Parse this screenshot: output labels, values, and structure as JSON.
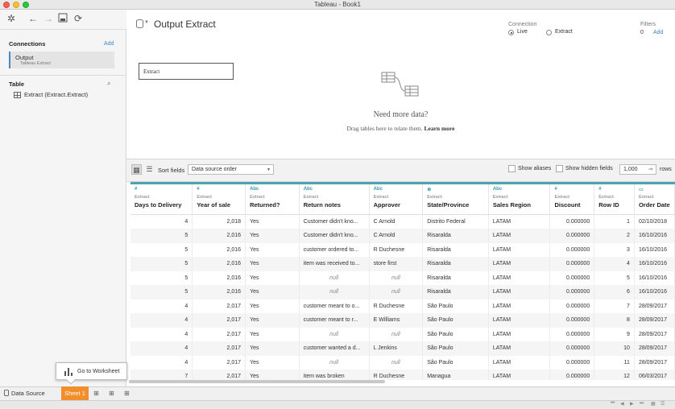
{
  "window": {
    "title": "Tableau - Book1"
  },
  "left_panel": {
    "connections_heading": "Connections",
    "connections_add": "Add",
    "connection": {
      "name": "Output",
      "type": "Tableau Extract"
    },
    "table_heading": "Table",
    "table_item": "Extract (Extract.Extract)"
  },
  "header": {
    "datasource_title": "Output Extract",
    "connection_label": "Connection",
    "connection_live": "Live",
    "connection_extract": "Extract",
    "connection_selected": "Live",
    "filters_label": "Filters",
    "filters_count": "0",
    "filters_add": "Add"
  },
  "canvas": {
    "table_box": "Extract",
    "need_more_title": "Need more data?",
    "need_more_text": "Drag tables here to relate them.",
    "learn_more": "Learn more"
  },
  "grid_toolbar": {
    "sort_label": "Sort fields",
    "sort_value": "Data source order",
    "show_aliases": "Show aliases",
    "show_hidden": "Show hidden fields",
    "rows_value": "1,000",
    "rows_label": "rows"
  },
  "columns": [
    {
      "type": "#",
      "source": "Extract",
      "name": "Days to Delivery"
    },
    {
      "type": "#",
      "source": "Extract",
      "name": "Year of sale"
    },
    {
      "type": "Abc",
      "source": "Extract",
      "name": "Returned?"
    },
    {
      "type": "Abc",
      "source": "Extract",
      "name": "Return notes"
    },
    {
      "type": "Abc",
      "source": "Extract",
      "name": "Approver"
    },
    {
      "type": "globe",
      "source": "Extract",
      "name": "State/Province"
    },
    {
      "type": "Abc",
      "source": "Extract",
      "name": "Sales Region"
    },
    {
      "type": "#",
      "source": "Extract",
      "name": "Discount"
    },
    {
      "type": "#",
      "source": "Extract",
      "name": "Row ID"
    },
    {
      "type": "calendar",
      "source": "Extract",
      "name": "Order Date"
    }
  ],
  "rows": [
    [
      "4",
      "2,018",
      "Yes",
      "Customer didn't kno...",
      "C Arnold",
      "Distrito Federal",
      "LATAM",
      "0.000000",
      "1",
      "02/10/2018"
    ],
    [
      "5",
      "2,016",
      "Yes",
      "Customer didn't kno...",
      "C Arnold",
      "Risaralda",
      "LATAM",
      "0.000000",
      "2",
      "16/10/2016"
    ],
    [
      "5",
      "2,016",
      "Yes",
      "customer ordered to...",
      "R Duchesne",
      "Risaralda",
      "LATAM",
      "0.000000",
      "3",
      "16/10/2016"
    ],
    [
      "5",
      "2,016",
      "Yes",
      "item was received to...",
      "store first",
      "Risaralda",
      "LATAM",
      "0.000000",
      "4",
      "16/10/2016"
    ],
    [
      "5",
      "2,016",
      "Yes",
      "null",
      "null",
      "Risaralda",
      "LATAM",
      "0.000000",
      "5",
      "16/10/2016"
    ],
    [
      "5",
      "2,016",
      "Yes",
      "null",
      "null",
      "Risaralda",
      "LATAM",
      "0.000000",
      "6",
      "16/10/2016"
    ],
    [
      "4",
      "2,017",
      "Yes",
      "customer meant to o...",
      "R Duchesne",
      "São Paulo",
      "LATAM",
      "0.000000",
      "7",
      "28/09/2017"
    ],
    [
      "4",
      "2,017",
      "Yes",
      "customer meant to r...",
      "E Williams",
      "São Paulo",
      "LATAM",
      "0.000000",
      "8",
      "28/09/2017"
    ],
    [
      "4",
      "2,017",
      "Yes",
      "null",
      "null",
      "São Paulo",
      "LATAM",
      "0.000000",
      "9",
      "28/09/2017"
    ],
    [
      "4",
      "2,017",
      "Yes",
      "customer wanted a d...",
      "L Jenkins",
      "São Paulo",
      "LATAM",
      "0.000000",
      "10",
      "28/09/2017"
    ],
    [
      "4",
      "2,017",
      "Yes",
      "null",
      "null",
      "São Paulo",
      "LATAM",
      "0.000000",
      "11",
      "28/09/2017"
    ],
    [
      "7",
      "2,017",
      "Yes",
      "item was broken",
      "R Duchesne",
      "Managua",
      "LATAM",
      "0.000000",
      "12",
      "06/03/2017"
    ]
  ],
  "bottom": {
    "datasource_tab": "Data Source",
    "sheet_tab": "Sheet 1",
    "tooltip": "Go to Worksheet"
  }
}
